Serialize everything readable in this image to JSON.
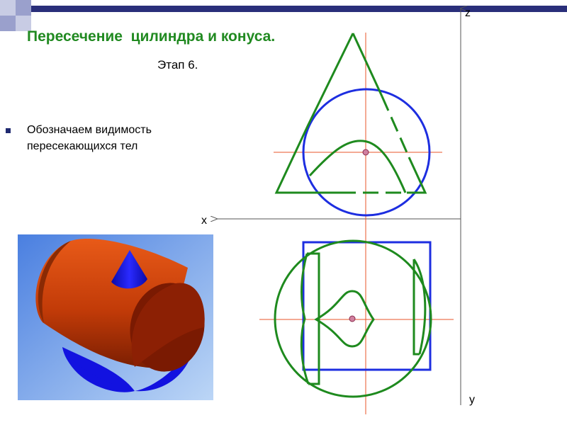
{
  "slide": {
    "title": "Пересечение  цилиндра и конуса.",
    "stage": "Этап 6.",
    "bullet": {
      "line1": "Обозначаем видимость",
      "line2": "пересекающихся тел"
    }
  },
  "axes": {
    "x": "x",
    "y": "y",
    "z": "z"
  },
  "colors": {
    "header_squares": "#c8cce4",
    "header_bar": "#2a2f7a",
    "title": "#218a21",
    "cone_outline": "#1e8a1e",
    "cylinder_outline": "#1d2ee0",
    "center_lines": "#e8552a",
    "axis_lines": "#555555",
    "render_background": "#6a9be8",
    "cylinder_render": "#c23b08",
    "cone_render": "#1212e0"
  }
}
